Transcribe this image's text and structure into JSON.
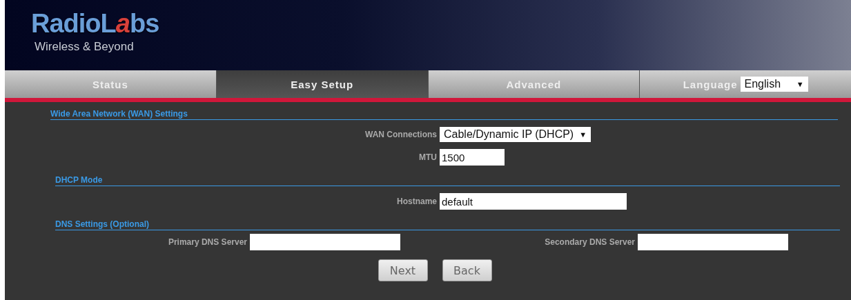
{
  "header": {
    "logo": [
      {
        "text": "RadioL",
        "accent": false
      },
      {
        "text": "a",
        "accent": true
      },
      {
        "text": "bs",
        "accent": false
      }
    ],
    "tagline": "Wireless & Beyond"
  },
  "tabs": [
    {
      "label": "Status",
      "selected": false
    },
    {
      "label": "Easy Setup",
      "selected": true
    },
    {
      "label": "Advanced",
      "selected": false
    }
  ],
  "language": {
    "label": "Language",
    "value": "English",
    "arrow": "▼"
  },
  "sections": [
    {
      "title": "Wide Area Network (WAN) Settings",
      "kind": "wide",
      "rows": [
        {
          "kind": "select",
          "label": "WAN Connections",
          "value": "Cable/Dynamic IP (DHCP)",
          "arrow": "▼"
        },
        {
          "kind": "short",
          "label": "MTU",
          "value": "1500"
        }
      ]
    },
    {
      "title": "DHCP Mode",
      "kind": "inset",
      "rows": [
        {
          "kind": "long",
          "label": "Hostname",
          "value": "default"
        }
      ]
    },
    {
      "title": "DNS Settings (Optional)",
      "kind": "inset",
      "rows": [
        {
          "kind": "pair",
          "fields": [
            {
              "label": "Primary DNS Server"
            },
            {
              "label": "Secondary DNS Server"
            }
          ]
        }
      ]
    }
  ],
  "buttons": [
    {
      "label": "Next"
    },
    {
      "label": "Back"
    }
  ]
}
